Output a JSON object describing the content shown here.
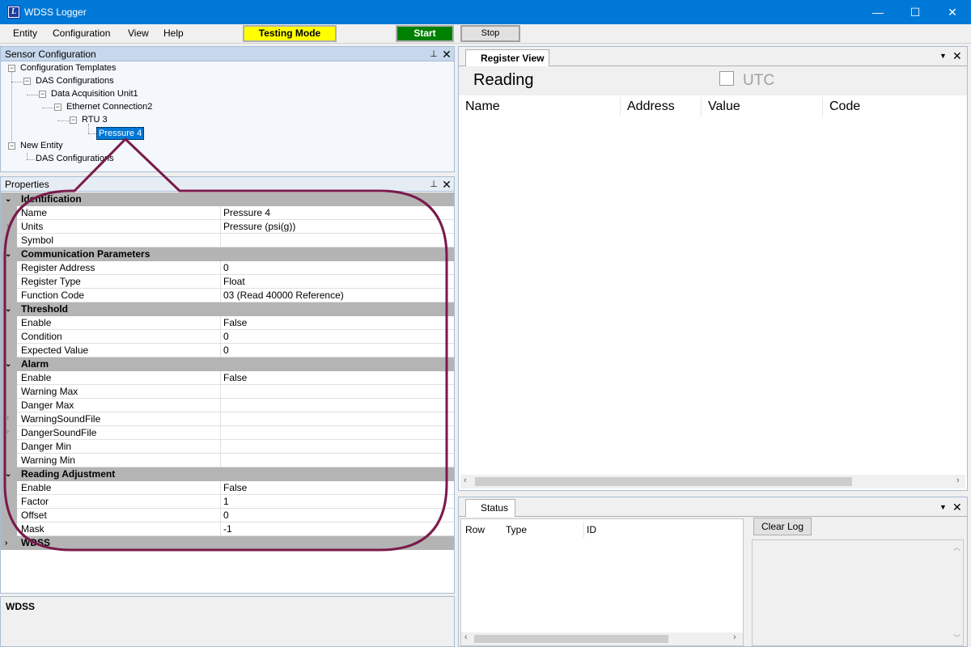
{
  "window": {
    "title": "WDSS Logger",
    "icon_letter": "L",
    "minimize_glyph": "—",
    "maximize_glyph": "☐",
    "close_glyph": "✕"
  },
  "menu": {
    "items": [
      "Entity",
      "Configuration",
      "View",
      "Help"
    ],
    "testing_mode": "Testing Mode",
    "start": "Start",
    "stop": "Stop"
  },
  "colors": {
    "titlebar": "#0078d7",
    "testing_mode_bg": "#ffff00",
    "start_bg": "#008000",
    "callout": "#7a1a4a",
    "selection": "#0078d7"
  },
  "sensor_panel": {
    "title": "Sensor Configuration",
    "tree": [
      {
        "label": "Configuration Templates",
        "level": 0,
        "expander": "−"
      },
      {
        "label": "DAS Configurations",
        "level": 1,
        "expander": "−"
      },
      {
        "label": "Data Acquisition Unit1",
        "level": 2,
        "expander": "−"
      },
      {
        "label": "Ethernet Connection2",
        "level": 3,
        "expander": "−"
      },
      {
        "label": "RTU 3",
        "level": 4,
        "expander": "−"
      },
      {
        "label": "Pressure 4",
        "level": 5,
        "selected": true
      },
      {
        "label": "New Entity",
        "level": 0,
        "expander": "−"
      },
      {
        "label": "DAS Configurations",
        "level": 1
      }
    ]
  },
  "properties": {
    "title": "Properties",
    "categories": [
      {
        "name": "Identification",
        "rows": [
          [
            "Name",
            "Pressure 4"
          ],
          [
            "Units",
            "Pressure (psi(g))"
          ],
          [
            "Symbol",
            ""
          ]
        ]
      },
      {
        "name": "Communication Parameters",
        "rows": [
          [
            "Register Address",
            "0"
          ],
          [
            "Register Type",
            "Float"
          ],
          [
            "Function Code",
            "03 (Read 40000 Reference)"
          ]
        ]
      },
      {
        "name": "Threshold",
        "rows": [
          [
            "Enable",
            "False"
          ],
          [
            "Condition",
            "0"
          ],
          [
            "Expected Value",
            "0"
          ]
        ]
      },
      {
        "name": "Alarm",
        "rows": [
          [
            "Enable",
            "False"
          ],
          [
            "Warning Max",
            ""
          ],
          [
            "Danger Max",
            ""
          ],
          [
            "WarningSoundFile",
            ""
          ],
          [
            "DangerSoundFile",
            ""
          ],
          [
            "Danger Min",
            ""
          ],
          [
            "Warning Min",
            ""
          ]
        ]
      },
      {
        "name": "Reading Adjustment",
        "rows": [
          [
            "Enable",
            "False"
          ],
          [
            "Factor",
            "1"
          ],
          [
            "Offset",
            "0"
          ],
          [
            "Mask",
            "-1"
          ]
        ]
      },
      {
        "name": "WDSS",
        "rows": [],
        "collapsed": true
      }
    ],
    "description": "WDSS"
  },
  "register_view": {
    "tab": "Register View",
    "reading": "Reading",
    "utc": "UTC",
    "columns": [
      "Name",
      "Address",
      "Value",
      "Code"
    ]
  },
  "status": {
    "tab": "Status",
    "columns": [
      "Row",
      "Type",
      "ID"
    ],
    "clear_log": "Clear Log"
  }
}
